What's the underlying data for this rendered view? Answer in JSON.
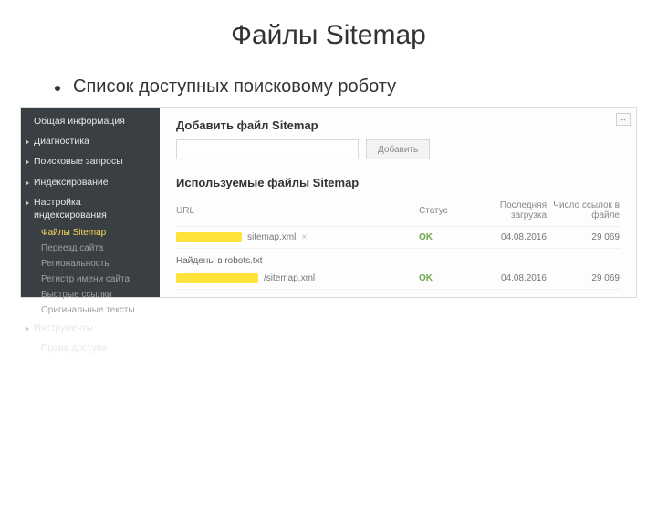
{
  "slide": {
    "title": "Файлы Sitemap",
    "bullet": "Список доступных поисковому роботу"
  },
  "sidebar": {
    "items": [
      {
        "label": "Общая информация"
      },
      {
        "label": "Диагностика"
      },
      {
        "label": "Поисковые запросы"
      },
      {
        "label": "Индексирование"
      },
      {
        "label": "Настройка индексирования"
      }
    ],
    "subs": [
      {
        "label": "Файлы Sitemap",
        "active": true
      },
      {
        "label": "Переезд сайта"
      },
      {
        "label": "Региональность"
      },
      {
        "label": "Регистр имени сайта"
      },
      {
        "label": "Быстрые ссылки"
      },
      {
        "label": "Оригинальные тексты"
      }
    ],
    "tail": [
      {
        "label": "Инструменты"
      },
      {
        "label": "Права доступа"
      }
    ]
  },
  "main": {
    "add_heading": "Добавить файл Sitemap",
    "input_placeholder": "",
    "add_button": "Добавить",
    "used_heading": "Используемые файлы Sitemap",
    "columns": {
      "url": "URL",
      "status": "Статус",
      "last_load": "Последняя загрузка",
      "link_count": "Число ссылок в файле"
    },
    "robots_subhead": "Найдены в robots.txt",
    "rows": [
      {
        "url_tail": "sitemap.xml",
        "status": "OK",
        "date": "04.08.2016",
        "count": "29 069",
        "removable": true
      },
      {
        "url_tail": "/sitemap.xml",
        "status": "OK",
        "date": "04.08.2016",
        "count": "29 069",
        "removable": false
      }
    ],
    "expand_glyph": "↔"
  }
}
